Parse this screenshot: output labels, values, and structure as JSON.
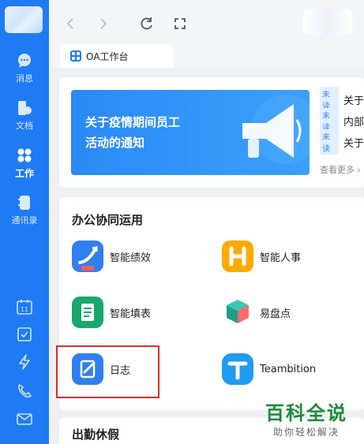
{
  "sidebar": {
    "items": [
      {
        "label": "消息",
        "icon": "chat-icon"
      },
      {
        "label": "文档",
        "icon": "document-icon"
      },
      {
        "label": "工作",
        "icon": "grid-icon"
      },
      {
        "label": "通讯录",
        "icon": "contacts-icon"
      }
    ],
    "tools": [
      "calendar-icon",
      "todo-icon",
      "lightning-icon",
      "phone-icon",
      "mail-icon"
    ],
    "calendar_day": "11"
  },
  "tab": {
    "label": "OA工作台"
  },
  "banner": {
    "line1": "关于疫情期间员工",
    "line2": "活动的通知"
  },
  "notices": [
    {
      "badge": "未读",
      "text": "关于"
    },
    {
      "badge": "未读",
      "text": "内部"
    },
    {
      "badge": "未读",
      "text": "关于"
    }
  ],
  "more_link": "查看更多 ›",
  "sections": {
    "office": "办公协同运用",
    "attendance": "出勤休假"
  },
  "apps": [
    {
      "label": "智能绩效",
      "icon": "performance-icon",
      "color": "#2f7ff0"
    },
    {
      "label": "智能人事",
      "icon": "hr-icon",
      "color": "#ffaa00"
    },
    {
      "label": "智能填表",
      "icon": "form-icon",
      "color": "#17a86b"
    },
    {
      "label": "易盘点",
      "icon": "inventory-icon",
      "color": "#26a69a"
    },
    {
      "label": "日志",
      "icon": "log-icon",
      "color": "#2f7ff0"
    },
    {
      "label": "Teambition",
      "icon": "teambition-icon",
      "color": "#1f9bf0"
    }
  ],
  "watermark": {
    "main": "百科全说",
    "sub": "助你轻松解决"
  },
  "colors": {
    "rail": "#1f7bf3",
    "highlight": "#d9302b",
    "brand": "#1f7bf3"
  }
}
